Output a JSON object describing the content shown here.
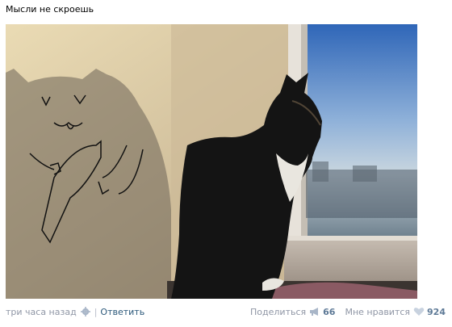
{
  "post": {
    "text": "Мысли не скроешь"
  },
  "photo": {
    "subject": "black-and-white cat at sunlit window with drawn-on shadow holding a fish"
  },
  "footer": {
    "timestamp": "три часа назад",
    "separator": "|",
    "reply_label": "Ответить",
    "share_label": "Поделиться",
    "share_count": "66",
    "like_label": "Мне нравится",
    "like_count": "924"
  },
  "colors": {
    "link": "#2b587a",
    "muted": "#8f96a5",
    "count": "#5e7a97",
    "icon": "#a9b6c8"
  }
}
